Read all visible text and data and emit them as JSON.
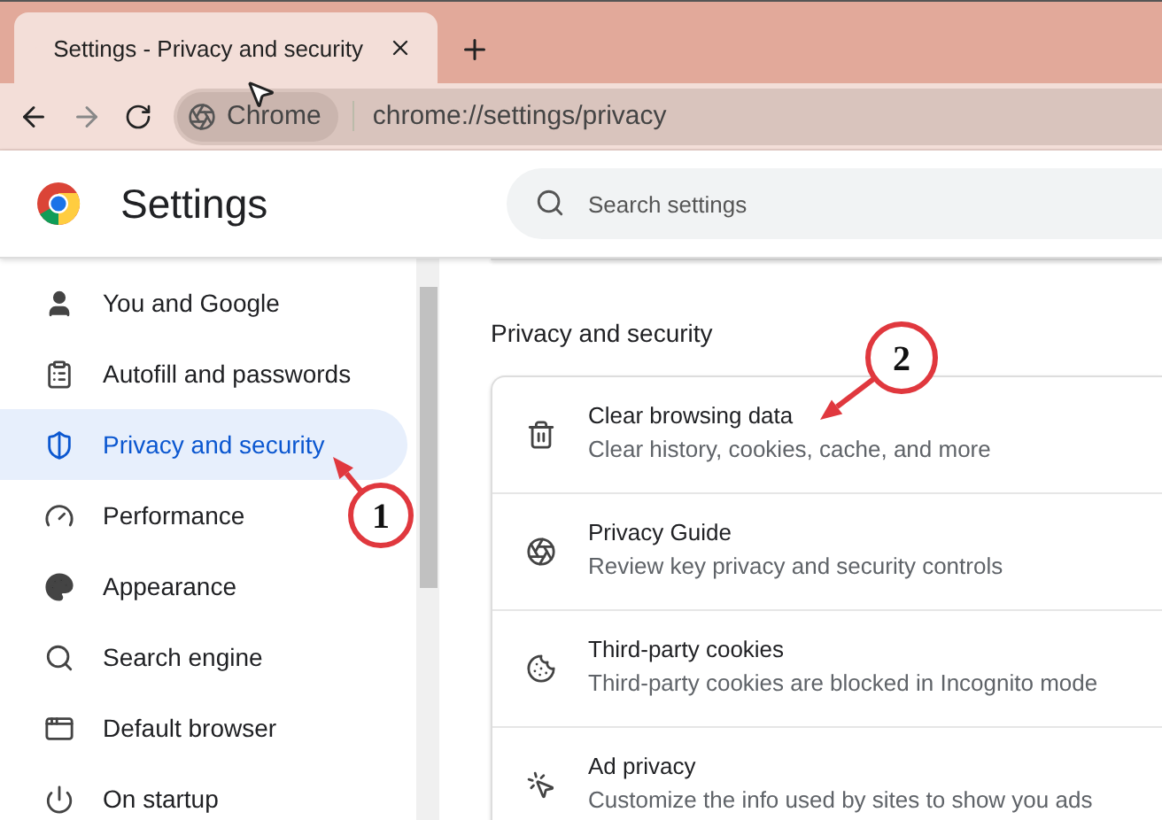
{
  "tab": {
    "title": "Settings - Privacy and security"
  },
  "address_bar": {
    "chip": "Chrome",
    "url": "chrome://settings/privacy"
  },
  "header": {
    "title": "Settings",
    "search": {
      "placeholder": "Search settings"
    }
  },
  "sidebar": {
    "items": [
      {
        "label": "You and Google",
        "selected": false
      },
      {
        "label": "Autofill and passwords",
        "selected": false
      },
      {
        "label": "Privacy and security",
        "selected": true
      },
      {
        "label": "Performance",
        "selected": false
      },
      {
        "label": "Appearance",
        "selected": false
      },
      {
        "label": "Search engine",
        "selected": false
      },
      {
        "label": "Default browser",
        "selected": false
      },
      {
        "label": "On startup",
        "selected": false
      }
    ]
  },
  "section": {
    "title": "Privacy and security",
    "rows": [
      {
        "title": "Clear browsing data",
        "subtitle": "Clear history, cookies, cache, and more"
      },
      {
        "title": "Privacy Guide",
        "subtitle": "Review key privacy and security controls"
      },
      {
        "title": "Third-party cookies",
        "subtitle": "Third-party cookies are blocked in Incognito mode"
      },
      {
        "title": "Ad privacy",
        "subtitle": "Customize the info used by sites to show you ads"
      }
    ]
  },
  "annotations": [
    {
      "label": "1"
    },
    {
      "label": "2"
    }
  ]
}
